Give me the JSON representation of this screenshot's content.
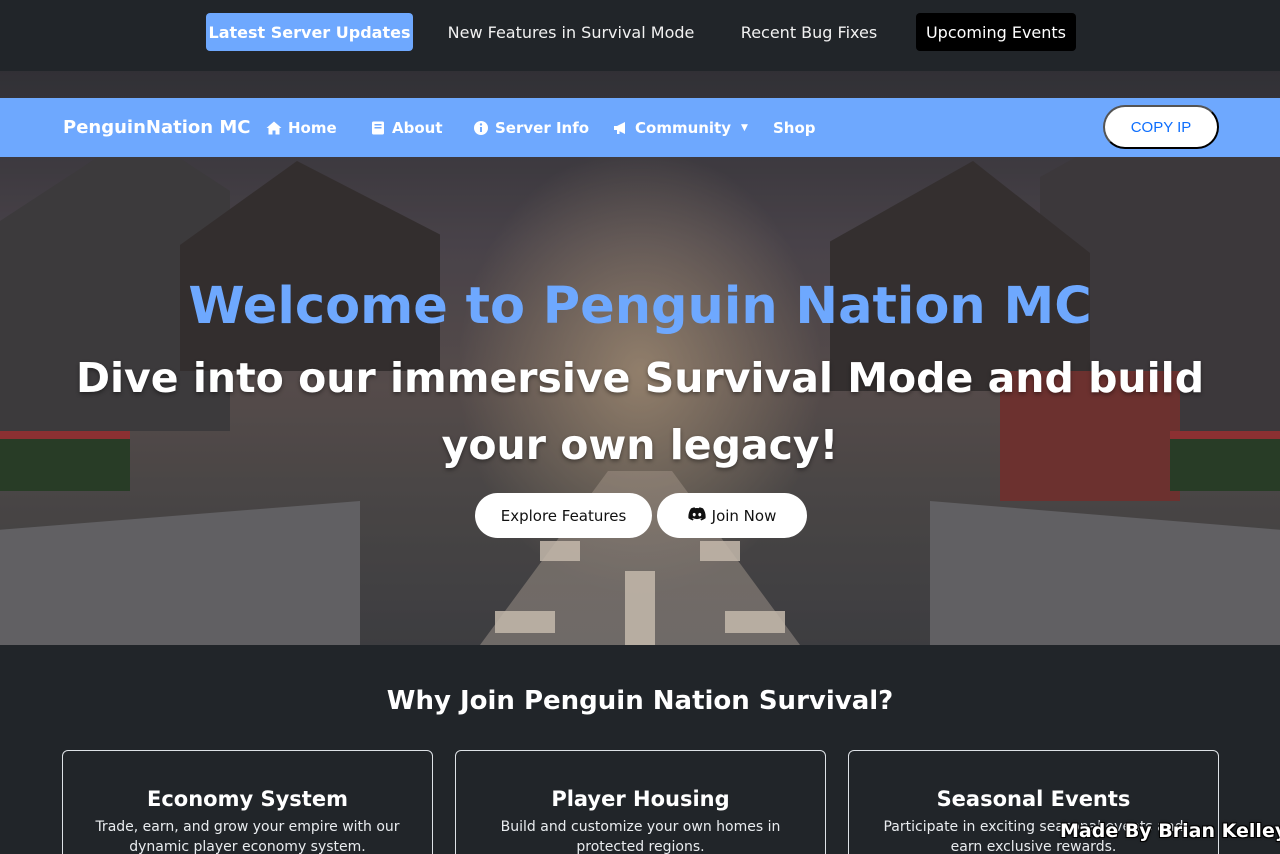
{
  "ticker": {
    "items": [
      {
        "label": "Latest Server Updates"
      },
      {
        "label": "New Features in Survival Mode"
      },
      {
        "label": "Recent Bug Fixes"
      },
      {
        "label": "Upcoming Events"
      }
    ]
  },
  "navbar": {
    "brand": "PenguinNation MC",
    "items": [
      {
        "label": "Home",
        "icon": "home-icon"
      },
      {
        "label": "About",
        "icon": "book-icon"
      },
      {
        "label": "Server Info",
        "icon": "info-circle-icon"
      },
      {
        "label": "Community",
        "icon": "megaphone-icon",
        "dropdown": true
      },
      {
        "label": "Shop"
      }
    ],
    "copy_ip": "COPY IP"
  },
  "hero": {
    "title": "Welcome to Penguin Nation MC",
    "subtitle": "Dive into our immersive Survival Mode and build your own legacy!",
    "explore_label": "Explore Features",
    "join_label": "Join Now",
    "join_icon": "discord-icon"
  },
  "features": {
    "heading": "Why Join Penguin Nation Survival?",
    "cards": [
      {
        "title": "Economy System",
        "text": "Trade, earn, and grow your empire with our dynamic player economy system."
      },
      {
        "title": "Player Housing",
        "text": "Build and customize your own homes in protected regions."
      },
      {
        "title": "Seasonal Events",
        "text": "Participate in exciting seasonal events and earn exclusive rewards."
      }
    ]
  },
  "credit": "Made By Brian Kelley",
  "colors": {
    "accent": "#6ea8fe",
    "background": "#212529",
    "copy_ip_text": "#0d6efd"
  }
}
